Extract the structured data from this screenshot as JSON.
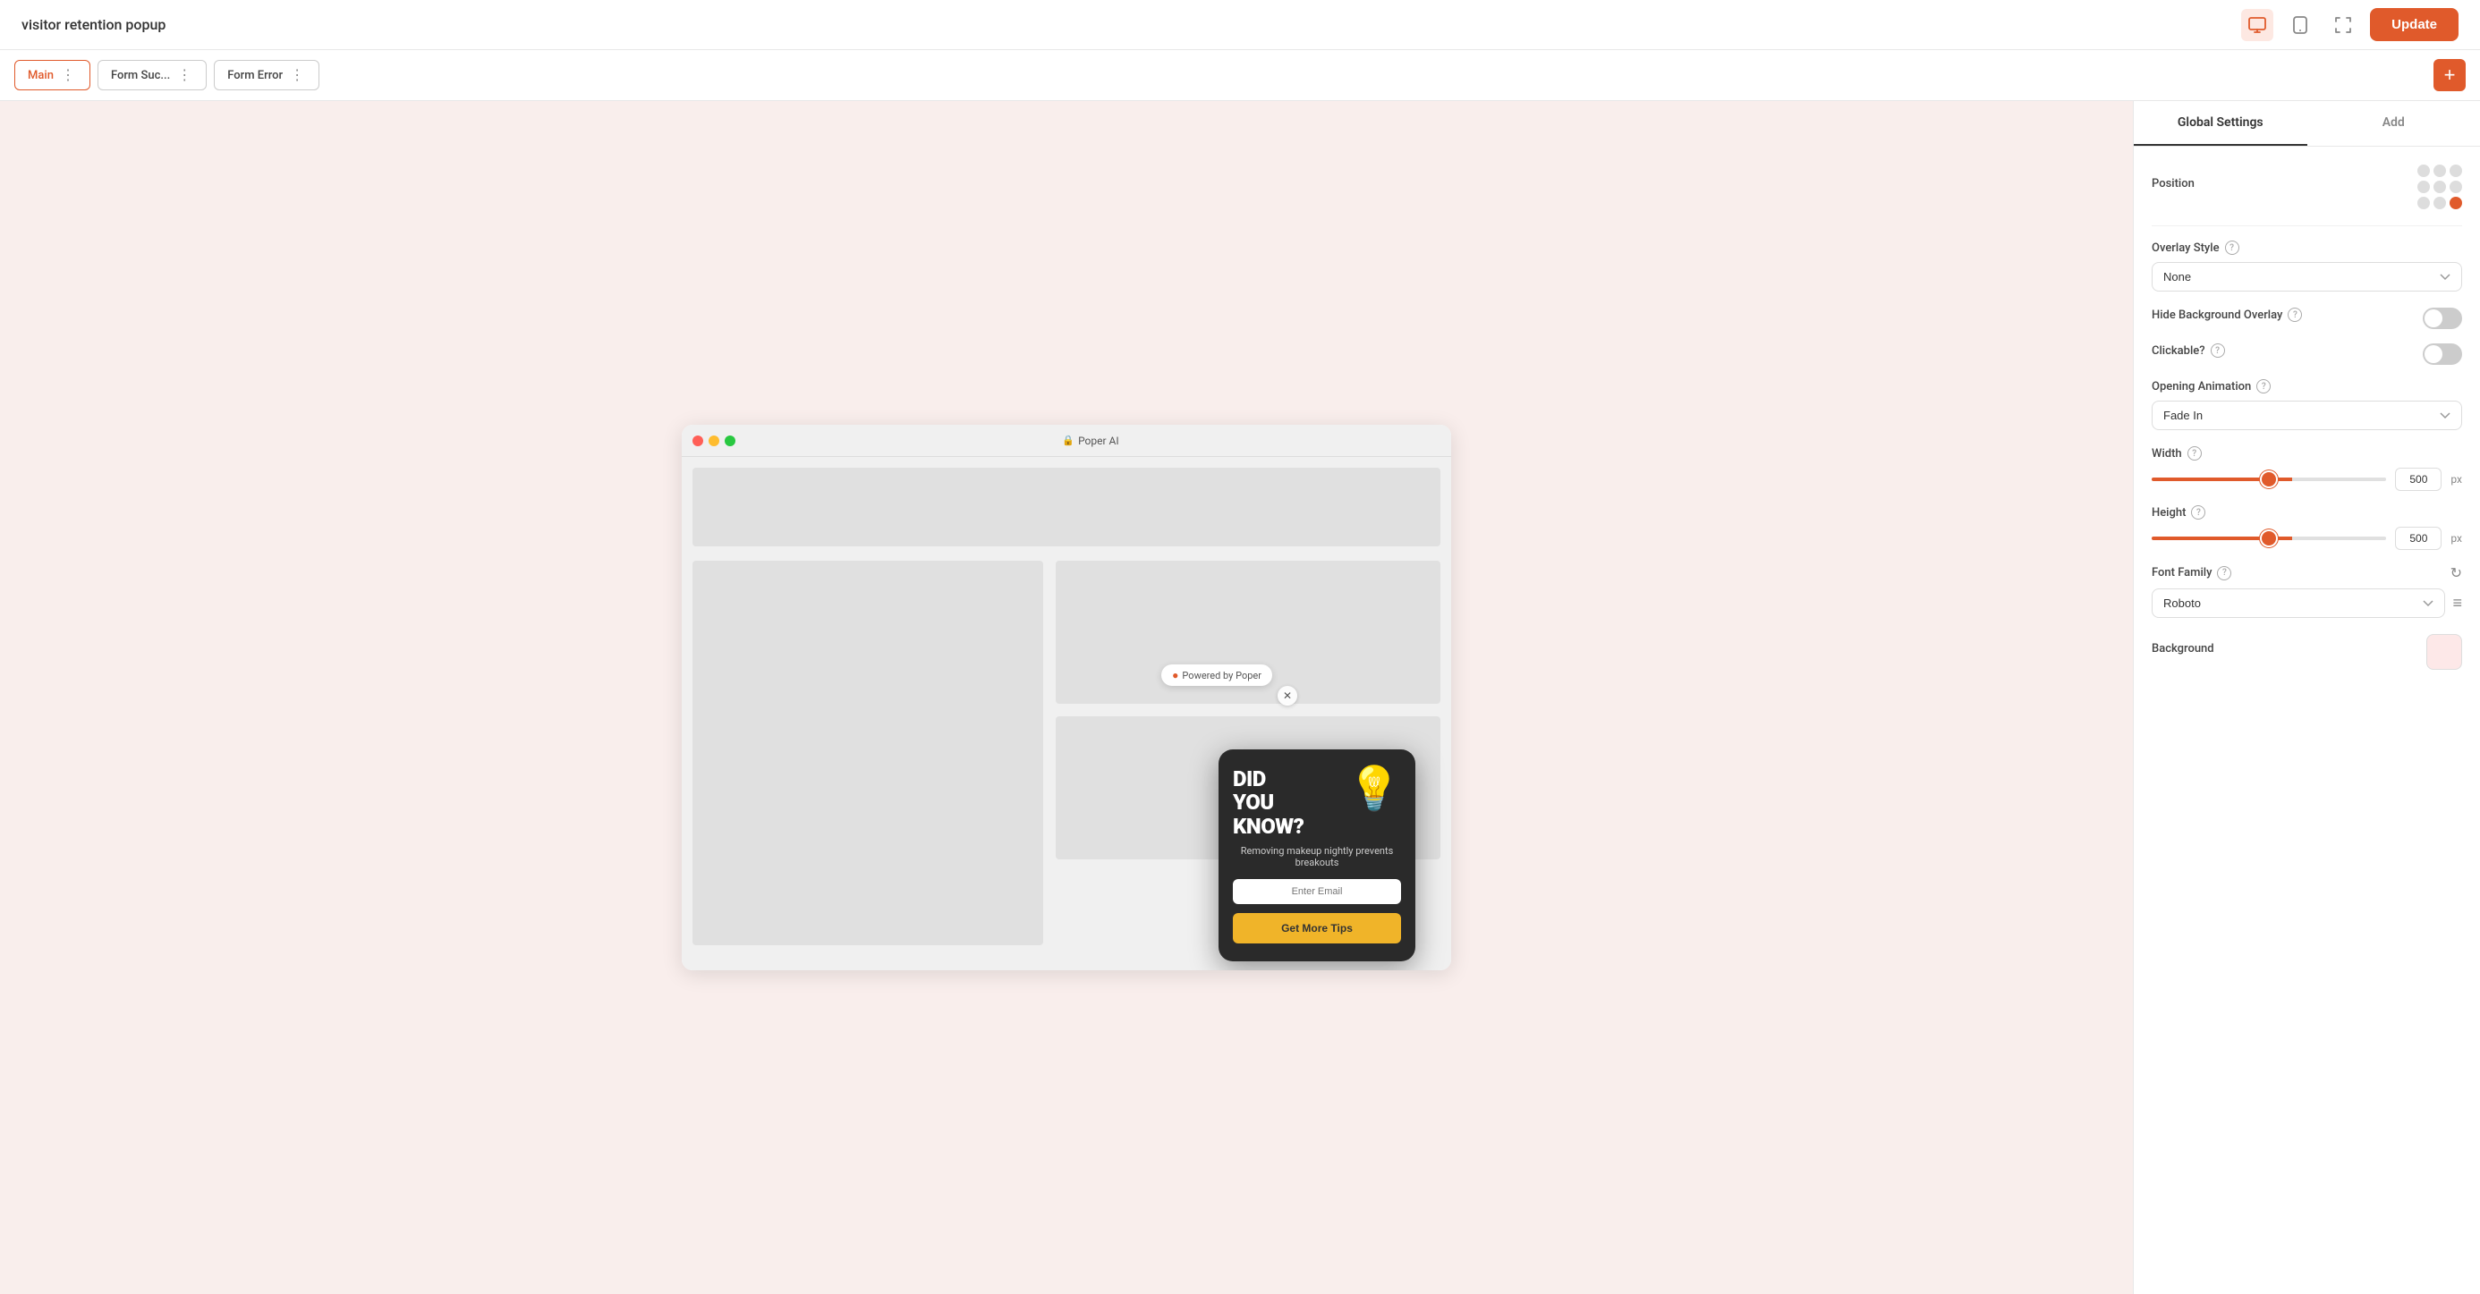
{
  "topbar": {
    "title": "visitor retention popup",
    "update_label": "Update"
  },
  "tabs": [
    {
      "id": "main",
      "label": "Main",
      "active": true
    },
    {
      "id": "form-success",
      "label": "Form Suc...",
      "active": false
    },
    {
      "id": "form-error",
      "label": "Form Error",
      "active": false
    }
  ],
  "browser": {
    "url": "Poper AI"
  },
  "popup": {
    "title": "DID\nYOU\nKNOW?",
    "subtitle": "Removing makeup nightly prevents breakouts",
    "input_placeholder": "Enter Email",
    "button_label": "Get More Tips"
  },
  "panel": {
    "tabs": [
      {
        "label": "Global Settings",
        "active": true
      },
      {
        "label": "Add",
        "active": false
      }
    ]
  },
  "settings": {
    "position_label": "Position",
    "overlay_style_label": "Overlay Style",
    "overlay_style_value": "None",
    "hide_overlay_label": "Hide Background Overlay",
    "clickable_label": "Clickable?",
    "opening_animation_label": "Opening Animation",
    "opening_animation_value": "Fade In",
    "width_label": "Width",
    "width_value": "500",
    "width_unit": "px",
    "height_label": "Height",
    "height_value": "500",
    "height_unit": "px",
    "font_family_label": "Font Family",
    "font_family_value": "Roboto",
    "background_label": "Background"
  }
}
